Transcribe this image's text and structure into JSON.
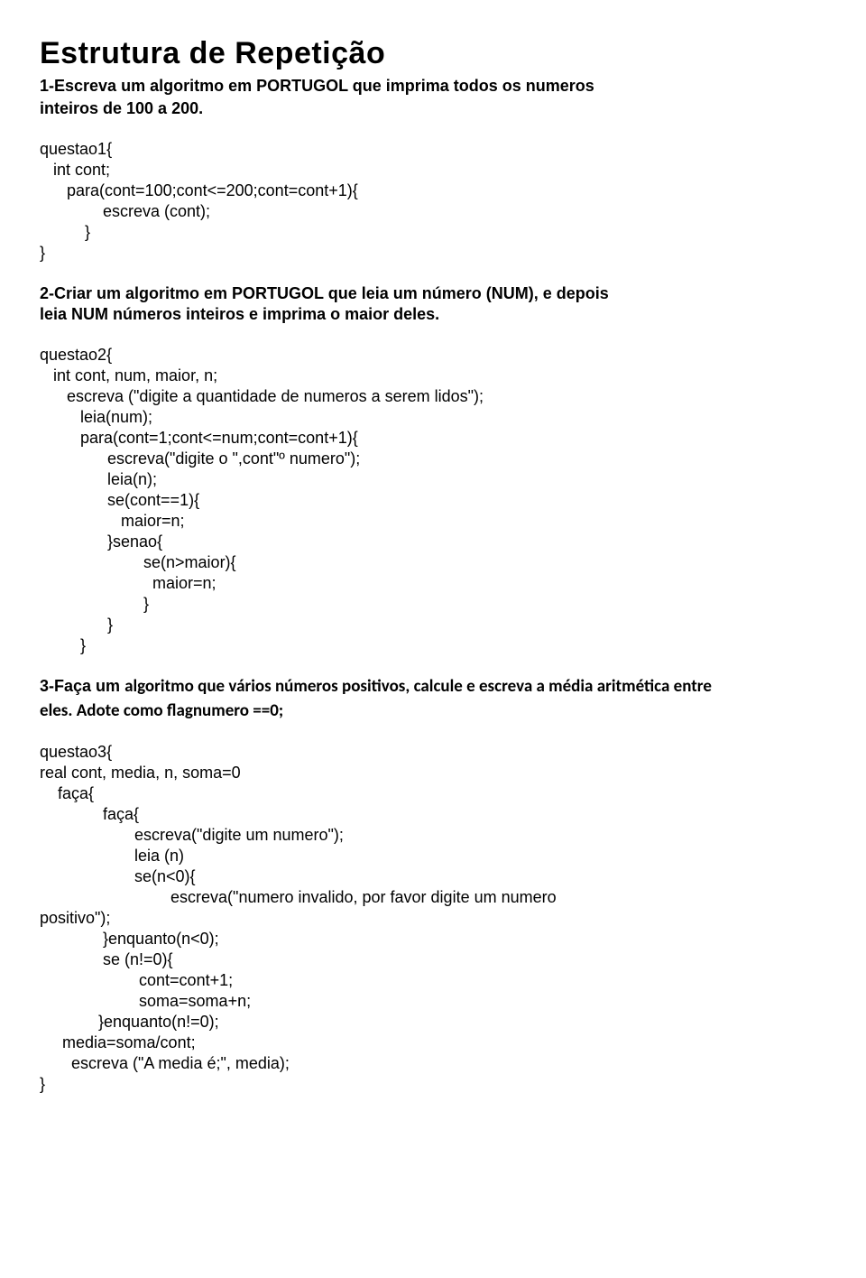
{
  "title": "Estrutura de Repetição",
  "q1": {
    "prompt_l1": "1-Escreva um algoritmo em PORTUGOL que imprima todos os numeros",
    "prompt_l2": "inteiros de 100 a 200.",
    "code": "questao1{\n   int cont;\n      para(cont=100;cont<=200;cont=cont+1){\n              escreva (cont);\n          }\n}"
  },
  "q2": {
    "prompt_l1": "2-Criar um algoritmo em PORTUGOL que leia um número (NUM), e depois",
    "prompt_l2": "leia NUM números inteiros e imprima o maior deles.",
    "code": "questao2{\n   int cont, num, maior, n;\n      escreva (\"digite a quantidade de numeros a serem lidos\");\n         leia(num);\n         para(cont=1;cont<=num;cont=cont+1){\n               escreva(\"digite o \",cont\"º numero\");\n               leia(n);\n               se(cont==1){\n                  maior=n;\n               }senao{\n                       se(n>maior){\n                         maior=n;\n                       }\n               }\n         }"
  },
  "q3": {
    "prompt_lead": "3-Faça um",
    "prompt_rest": "algoritmo que vários números positivos, calcule e escreva a média aritmética entre",
    "prompt_l2": "eles. Adote como flagnumero ==0;",
    "code": "questao3{ \nreal cont, media, n, soma=0\n    faça{\n              faça{\n                     escreva(\"digite um numero\");\n                     leia (n)\n                     se(n<0){\n                             escreva(\"numero invalido, por favor digite um numero\npositivo\");\n              }enquanto(n<0);\n              se (n!=0){\n                      cont=cont+1;\n                      soma=soma+n;\n             }enquanto(n!=0);\n     media=soma/cont;\n       escreva (\"A media é;\", media);\n}"
  }
}
